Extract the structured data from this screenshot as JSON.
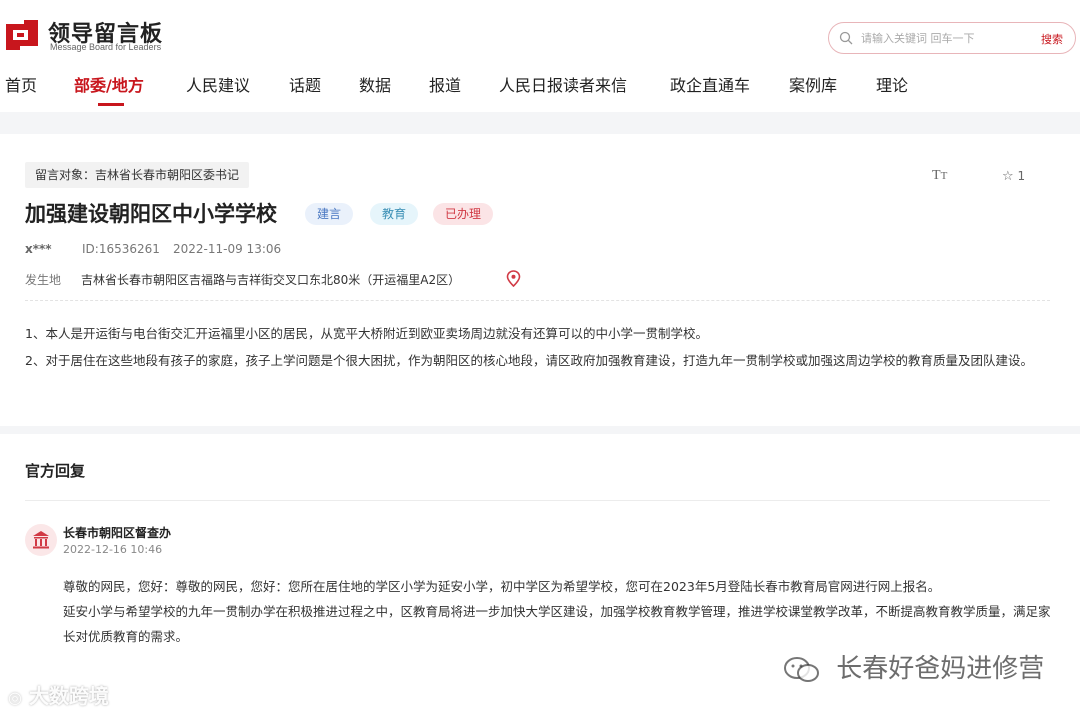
{
  "header": {
    "logo_title": "领导留言板",
    "logo_subtitle": "Message Board for Leaders",
    "brand_color": "#c8161d",
    "search": {
      "placeholder": "请输入关键词 回车一下",
      "button_label": "搜索"
    }
  },
  "nav": {
    "items": [
      {
        "label": "首页"
      },
      {
        "label": "部委/地方"
      },
      {
        "label": "人民建议"
      },
      {
        "label": "话题"
      },
      {
        "label": "数据"
      },
      {
        "label": "报道"
      },
      {
        "label": "人民日报读者来信"
      },
      {
        "label": "政企直通车"
      },
      {
        "label": "案例库"
      },
      {
        "label": "理论"
      }
    ],
    "active_label": "部委/地方"
  },
  "message": {
    "target_tag": "留言对象：吉林省长春市朝阳区委书记",
    "fontsize_icon": "text-size-icon",
    "favorite_count": "1",
    "title": "加强建设朝阳区中小学学校",
    "badges": {
      "type": "建言",
      "field": "教育",
      "status": "已办理"
    },
    "author": "x***",
    "id": "ID:16536261",
    "datetime": "2022-11-09 13:06",
    "location_label": "发生地",
    "location_value": "吉林省长春市朝阳区吉福路与吉祥街交叉口东北80米（开运福里A2区）",
    "body": [
      "1、本人是开运街与电台街交汇开运福里小区的居民，从宽平大桥附近到欧亚卖场周边就没有还算可以的中小学一贯制学校。",
      "2、对于居住在这些地段有孩子的家庭，孩子上学问题是个很大困扰，作为朝阳区的核心地段，请区政府加强教育建设，打造九年一贯制学校或加强这周边学校的教育质量及团队建设。"
    ]
  },
  "reply": {
    "heading": "官方回复",
    "org_name": "长春市朝阳区督查办",
    "date": "2022-12-16 10:46",
    "body": [
      "尊敬的网民，您好：尊敬的网民，您好：您所在居住地的学区小学为延安小学，初中学区为希望学校，您可在2023年5月登陆长春市教育局官网进行网上报名。",
      "延安小学与希望学校的九年一贯制办学在积极推进过程之中，区教育局将进一步加快大学区建设，加强学校教育教学管理，推进学校课堂教学改革，不断提高教育教学质量，满足家长对优质教育的需求。"
    ]
  },
  "watermarks": {
    "left": "大数跨境",
    "right": "长春好爸妈进修营"
  }
}
